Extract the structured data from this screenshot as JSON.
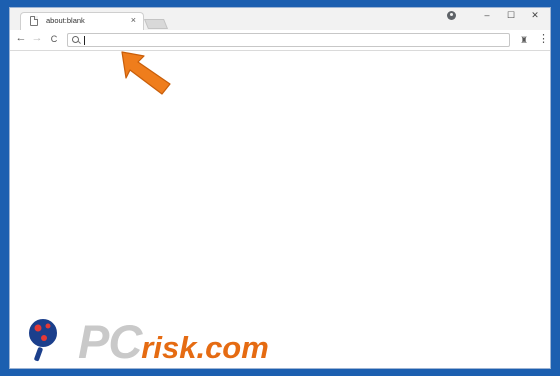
{
  "browser": {
    "tab": {
      "title": "about:blank",
      "close_glyph": "×"
    },
    "window_controls": {
      "minimize": "–",
      "maximize": "☐",
      "close": "✕"
    },
    "toolbar": {
      "back": "←",
      "forward": "→",
      "reload": "C",
      "url_value": "",
      "extension_glyph": "♜",
      "menu_glyph": "⋮"
    }
  },
  "watermark": {
    "brand_main": "PC",
    "brand_suffix": "risk.com"
  },
  "colors": {
    "frame": "#1c5fb0",
    "arrow": "#ef7d1c",
    "watermark_gray": "#c9c9c9",
    "watermark_orange": "#e56b12"
  },
  "icons": [
    "page-icon",
    "close-icon",
    "profile-icon",
    "minimize-icon",
    "maximize-icon",
    "back-icon",
    "forward-icon",
    "reload-icon",
    "search-icon",
    "extension-icon",
    "menu-icon",
    "pointer-arrow-icon",
    "magnifier-logo-icon"
  ]
}
